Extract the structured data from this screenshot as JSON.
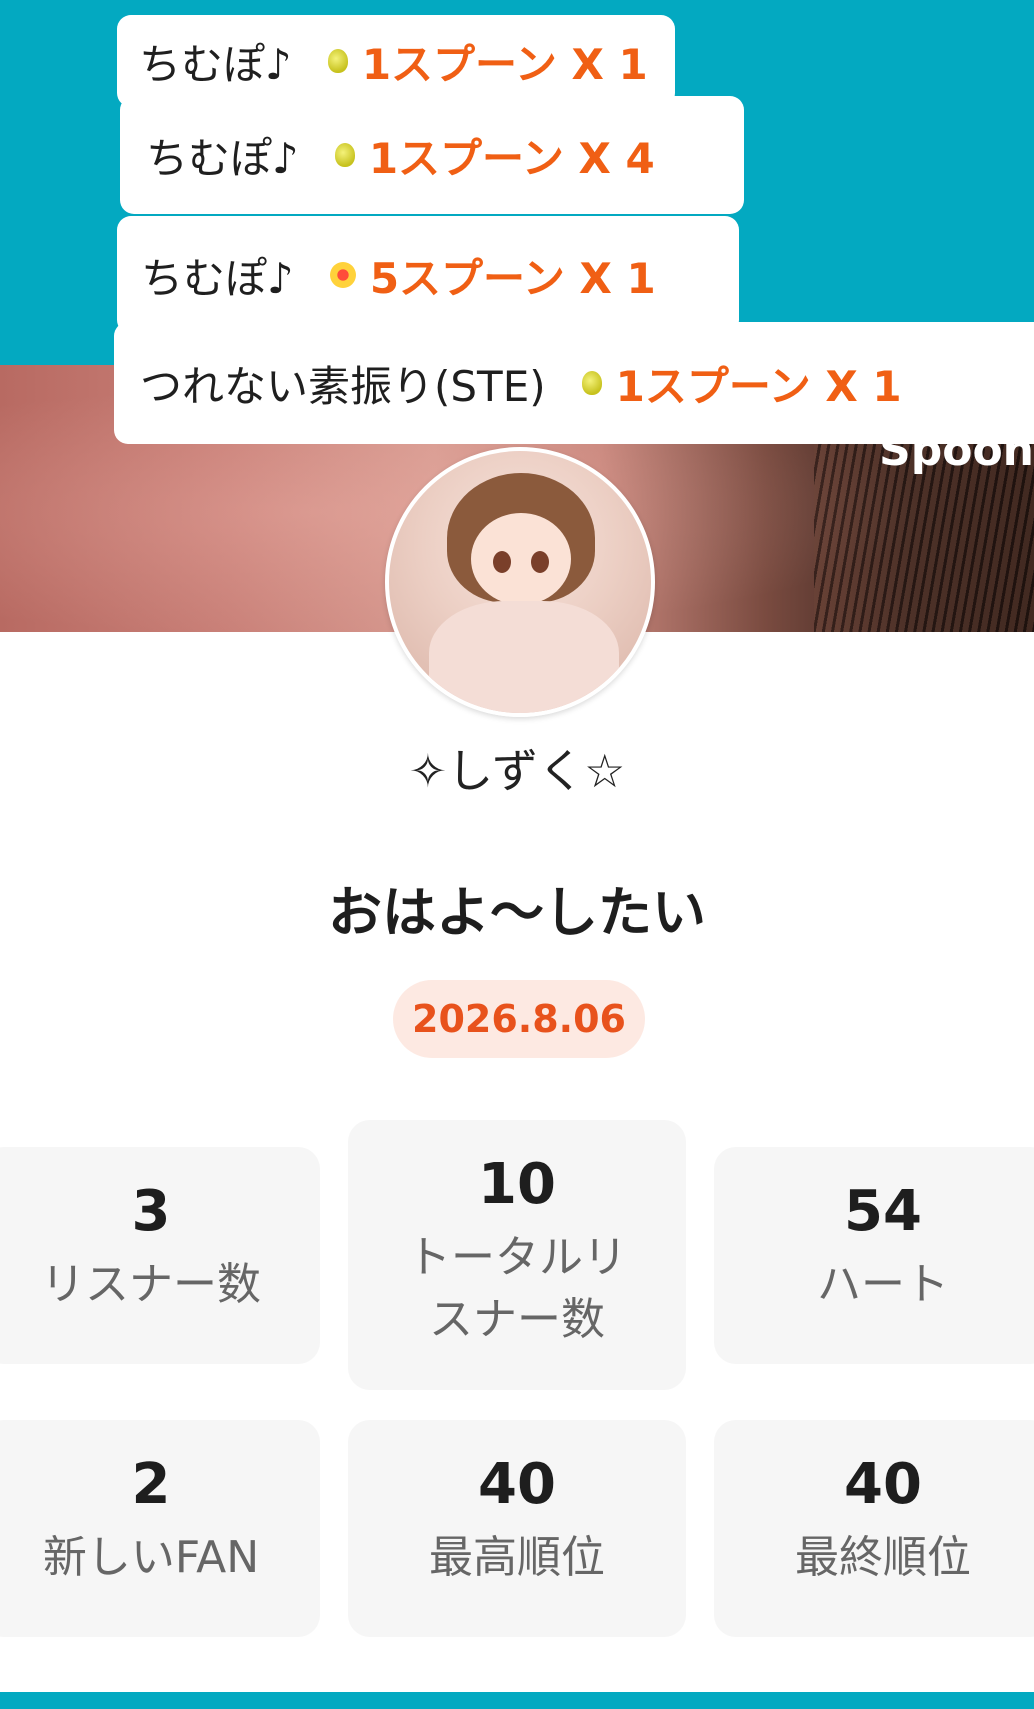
{
  "gift_feed": [
    {
      "user": "ちむぽ♪",
      "icon": "lemon-spoon-icon",
      "amount": "1スプーン X 1"
    },
    {
      "user": "ちむぽ♪",
      "icon": "lemon-spoon-icon",
      "amount": "1スプーン X 4"
    },
    {
      "user": "ちむぽ♪",
      "icon": "star-spoon-icon",
      "amount": "5スプーン X 1"
    },
    {
      "user": "つれない素振り(STE)",
      "icon": "lemon-spoon-icon",
      "amount": "1スプーン X 1"
    }
  ],
  "banner": {
    "watermark": "Spoon"
  },
  "profile": {
    "name": "✧しずく☆"
  },
  "room": {
    "title": "おはよ〜したい",
    "date": "2026.8.06"
  },
  "stats": [
    {
      "value": "3",
      "label": "リスナー数"
    },
    {
      "value": "10",
      "label": "トータルリスナー数"
    },
    {
      "value": "54",
      "label": "ハート"
    },
    {
      "value": "2",
      "label": "新しいFAN"
    },
    {
      "value": "40",
      "label": "最高順位"
    },
    {
      "value": "40",
      "label": "最終順位"
    }
  ],
  "colors": {
    "teal": "#03a9c1",
    "accent_orange": "#f05f14",
    "date_bg": "#fde9e2"
  }
}
